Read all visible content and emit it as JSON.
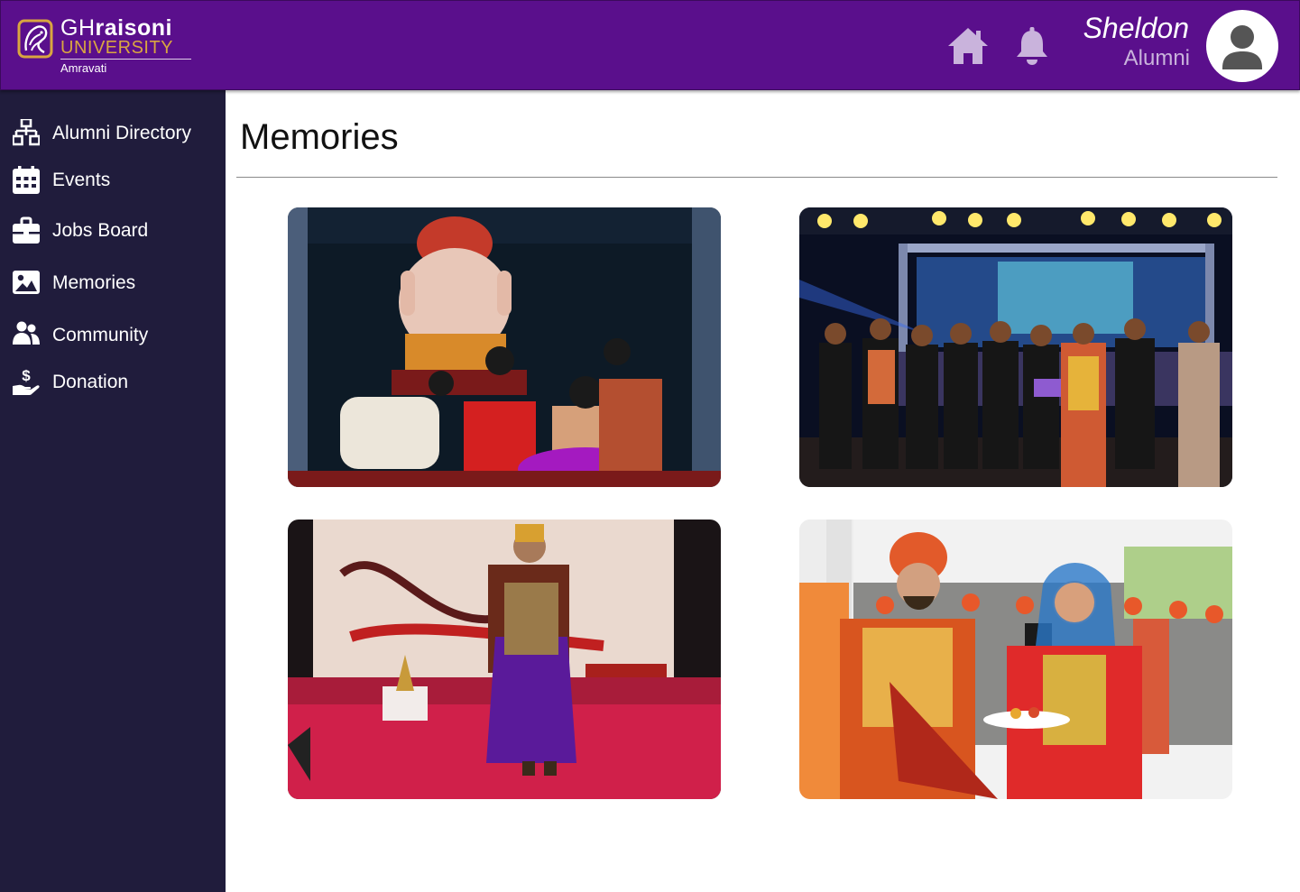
{
  "header": {
    "logo": {
      "brand_light": "GH",
      "brand_bold": "raisoni",
      "line2": "UNIVERSITY",
      "campus": "Amravati"
    },
    "home_icon": "home-icon",
    "bell_icon": "bell-icon",
    "user": {
      "name": "Sheldon",
      "role": "Alumni",
      "avatar_icon": "user-avatar-icon"
    }
  },
  "sidebar": {
    "items": [
      {
        "label": "Alumni Directory",
        "icon": "sitemap-icon"
      },
      {
        "label": "Events",
        "icon": "calendar-icon"
      },
      {
        "label": "Jobs Board",
        "icon": "briefcase-icon"
      },
      {
        "label": "Memories",
        "icon": "image-icon"
      },
      {
        "label": "Community",
        "icon": "users-icon"
      },
      {
        "label": "Donation",
        "icon": "hand-holding-dollar-icon"
      }
    ]
  },
  "main": {
    "title": "Memories"
  },
  "colors": {
    "header_bg": "#5a0f8c",
    "sidebar_bg": "#201c3c",
    "logo_gold": "#d9a640",
    "icon_tint": "#c9b3dc"
  }
}
